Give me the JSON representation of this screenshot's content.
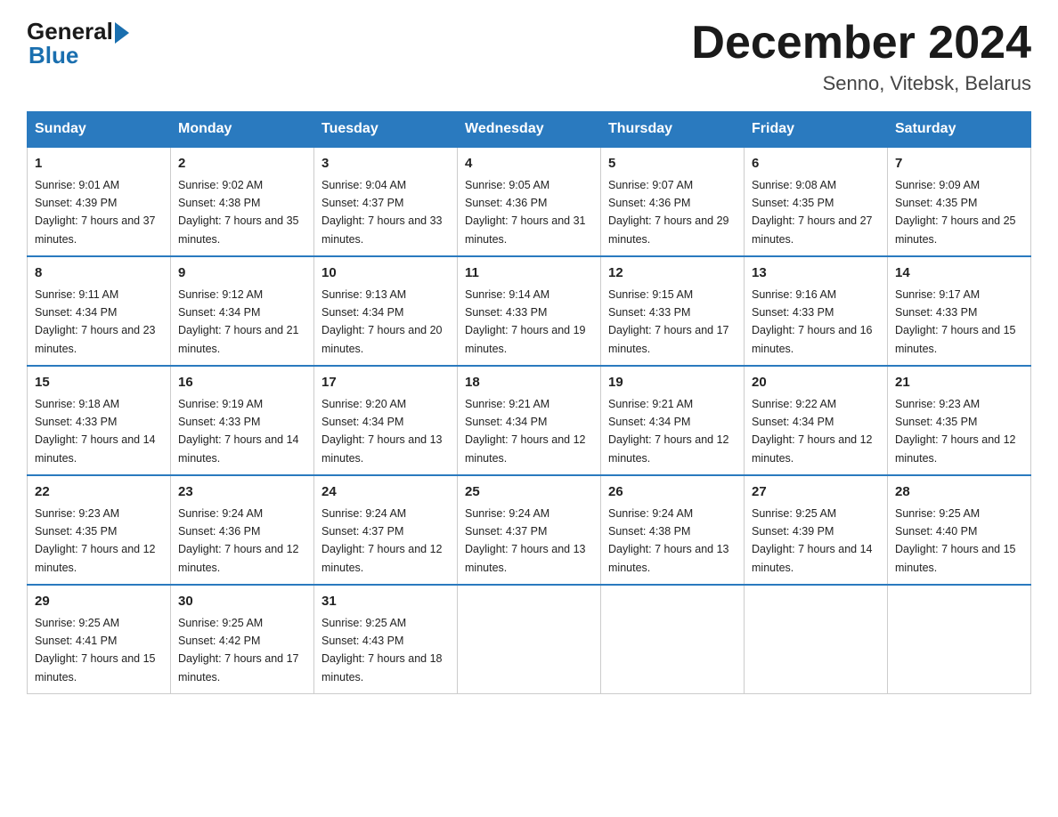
{
  "logo": {
    "general": "General",
    "blue": "Blue"
  },
  "title": {
    "month": "December 2024",
    "location": "Senno, Vitebsk, Belarus"
  },
  "weekdays": [
    "Sunday",
    "Monday",
    "Tuesday",
    "Wednesday",
    "Thursday",
    "Friday",
    "Saturday"
  ],
  "weeks": [
    [
      {
        "day": "1",
        "sunrise": "9:01 AM",
        "sunset": "4:39 PM",
        "daylight": "7 hours and 37 minutes."
      },
      {
        "day": "2",
        "sunrise": "9:02 AM",
        "sunset": "4:38 PM",
        "daylight": "7 hours and 35 minutes."
      },
      {
        "day": "3",
        "sunrise": "9:04 AM",
        "sunset": "4:37 PM",
        "daylight": "7 hours and 33 minutes."
      },
      {
        "day": "4",
        "sunrise": "9:05 AM",
        "sunset": "4:36 PM",
        "daylight": "7 hours and 31 minutes."
      },
      {
        "day": "5",
        "sunrise": "9:07 AM",
        "sunset": "4:36 PM",
        "daylight": "7 hours and 29 minutes."
      },
      {
        "day": "6",
        "sunrise": "9:08 AM",
        "sunset": "4:35 PM",
        "daylight": "7 hours and 27 minutes."
      },
      {
        "day": "7",
        "sunrise": "9:09 AM",
        "sunset": "4:35 PM",
        "daylight": "7 hours and 25 minutes."
      }
    ],
    [
      {
        "day": "8",
        "sunrise": "9:11 AM",
        "sunset": "4:34 PM",
        "daylight": "7 hours and 23 minutes."
      },
      {
        "day": "9",
        "sunrise": "9:12 AM",
        "sunset": "4:34 PM",
        "daylight": "7 hours and 21 minutes."
      },
      {
        "day": "10",
        "sunrise": "9:13 AM",
        "sunset": "4:34 PM",
        "daylight": "7 hours and 20 minutes."
      },
      {
        "day": "11",
        "sunrise": "9:14 AM",
        "sunset": "4:33 PM",
        "daylight": "7 hours and 19 minutes."
      },
      {
        "day": "12",
        "sunrise": "9:15 AM",
        "sunset": "4:33 PM",
        "daylight": "7 hours and 17 minutes."
      },
      {
        "day": "13",
        "sunrise": "9:16 AM",
        "sunset": "4:33 PM",
        "daylight": "7 hours and 16 minutes."
      },
      {
        "day": "14",
        "sunrise": "9:17 AM",
        "sunset": "4:33 PM",
        "daylight": "7 hours and 15 minutes."
      }
    ],
    [
      {
        "day": "15",
        "sunrise": "9:18 AM",
        "sunset": "4:33 PM",
        "daylight": "7 hours and 14 minutes."
      },
      {
        "day": "16",
        "sunrise": "9:19 AM",
        "sunset": "4:33 PM",
        "daylight": "7 hours and 14 minutes."
      },
      {
        "day": "17",
        "sunrise": "9:20 AM",
        "sunset": "4:34 PM",
        "daylight": "7 hours and 13 minutes."
      },
      {
        "day": "18",
        "sunrise": "9:21 AM",
        "sunset": "4:34 PM",
        "daylight": "7 hours and 12 minutes."
      },
      {
        "day": "19",
        "sunrise": "9:21 AM",
        "sunset": "4:34 PM",
        "daylight": "7 hours and 12 minutes."
      },
      {
        "day": "20",
        "sunrise": "9:22 AM",
        "sunset": "4:34 PM",
        "daylight": "7 hours and 12 minutes."
      },
      {
        "day": "21",
        "sunrise": "9:23 AM",
        "sunset": "4:35 PM",
        "daylight": "7 hours and 12 minutes."
      }
    ],
    [
      {
        "day": "22",
        "sunrise": "9:23 AM",
        "sunset": "4:35 PM",
        "daylight": "7 hours and 12 minutes."
      },
      {
        "day": "23",
        "sunrise": "9:24 AM",
        "sunset": "4:36 PM",
        "daylight": "7 hours and 12 minutes."
      },
      {
        "day": "24",
        "sunrise": "9:24 AM",
        "sunset": "4:37 PM",
        "daylight": "7 hours and 12 minutes."
      },
      {
        "day": "25",
        "sunrise": "9:24 AM",
        "sunset": "4:37 PM",
        "daylight": "7 hours and 13 minutes."
      },
      {
        "day": "26",
        "sunrise": "9:24 AM",
        "sunset": "4:38 PM",
        "daylight": "7 hours and 13 minutes."
      },
      {
        "day": "27",
        "sunrise": "9:25 AM",
        "sunset": "4:39 PM",
        "daylight": "7 hours and 14 minutes."
      },
      {
        "day": "28",
        "sunrise": "9:25 AM",
        "sunset": "4:40 PM",
        "daylight": "7 hours and 15 minutes."
      }
    ],
    [
      {
        "day": "29",
        "sunrise": "9:25 AM",
        "sunset": "4:41 PM",
        "daylight": "7 hours and 15 minutes."
      },
      {
        "day": "30",
        "sunrise": "9:25 AM",
        "sunset": "4:42 PM",
        "daylight": "7 hours and 17 minutes."
      },
      {
        "day": "31",
        "sunrise": "9:25 AM",
        "sunset": "4:43 PM",
        "daylight": "7 hours and 18 minutes."
      },
      null,
      null,
      null,
      null
    ]
  ]
}
